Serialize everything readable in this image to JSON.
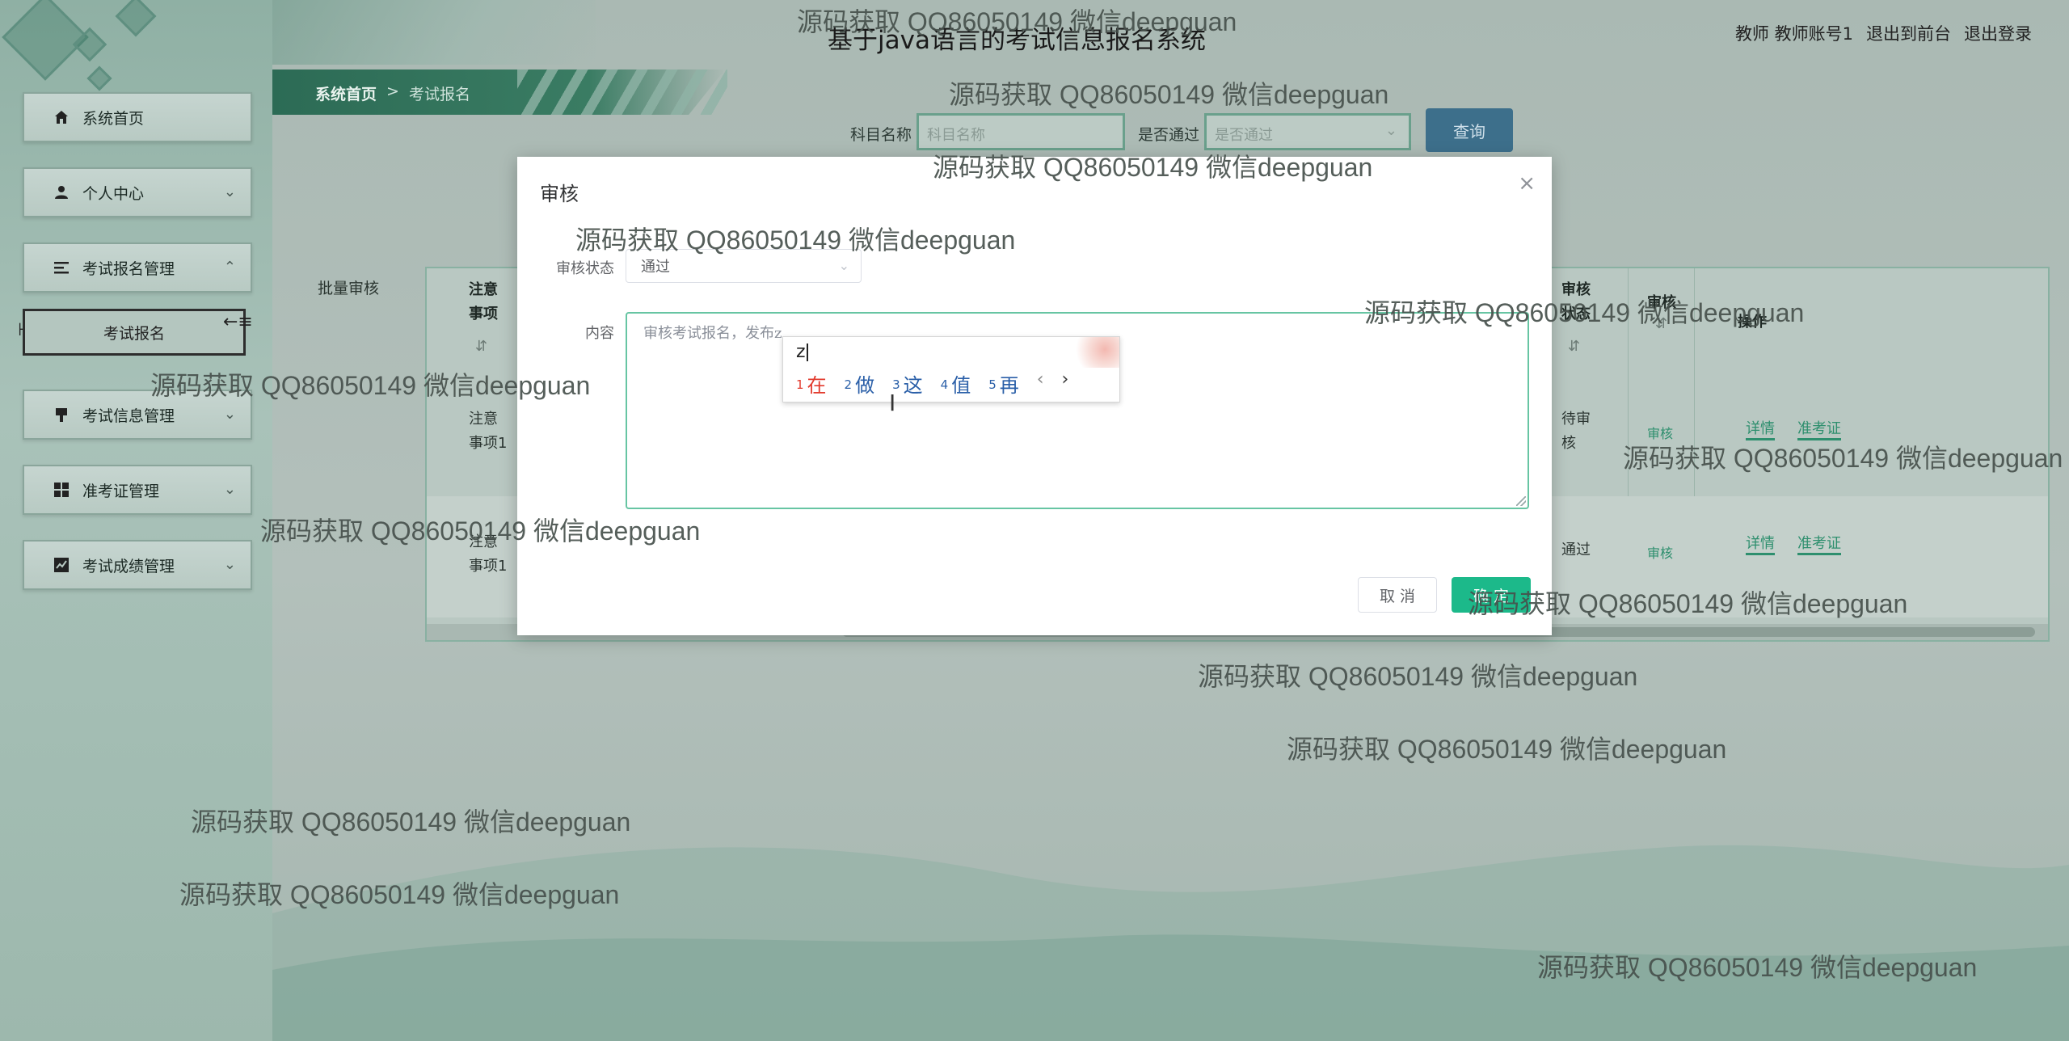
{
  "header": {
    "app_title": "基于java语言的考试信息报名系统",
    "user_role": "教师",
    "user_name": "教师账号1",
    "to_frontend": "退出到前台",
    "logout": "退出登录"
  },
  "breadcrumb": {
    "home": "系统首页",
    "separator": ">",
    "current": "考试报名"
  },
  "sidebar": {
    "items": [
      {
        "label": "系统首页",
        "icon": "home-icon"
      },
      {
        "label": "个人中心",
        "icon": "user-icon"
      },
      {
        "label": "考试报名管理",
        "icon": "list-icon",
        "expanded": true,
        "children": [
          "考试报名"
        ]
      },
      {
        "label": "考试信息管理",
        "icon": "pin-icon"
      },
      {
        "label": "准考证管理",
        "icon": "grid-icon"
      },
      {
        "label": "考试成绩管理",
        "icon": "chart-icon"
      }
    ]
  },
  "search": {
    "subject_label": "科目名称",
    "subject_placeholder": "科目名称",
    "passed_label": "是否通过",
    "passed_placeholder": "是否通过",
    "query_button": "查询"
  },
  "table": {
    "batch_review": "批量审核",
    "headers": {
      "notes": "注意事项",
      "review_status": "审核状态",
      "review": "审核",
      "actions": "操作"
    },
    "rows": [
      {
        "notes": "注意事项1",
        "status": "待审核",
        "review": "审核",
        "detail": "详情",
        "ticket": "准考证"
      },
      {
        "notes": "注意事项1",
        "status": "通过",
        "review": "审核",
        "detail": "详情",
        "ticket": "准考证"
      }
    ]
  },
  "modal": {
    "title": "审核",
    "status_label": "审核状态",
    "status_value": "通过",
    "content_label": "内容",
    "content_value": "审核考试报名，发布z",
    "cancel": "取 消",
    "confirm": "确 定"
  },
  "ime": {
    "composition": "z",
    "candidates": [
      {
        "num": "1",
        "text": "在"
      },
      {
        "num": "2",
        "text": "做"
      },
      {
        "num": "3",
        "text": "这"
      },
      {
        "num": "4",
        "text": "值"
      },
      {
        "num": "5",
        "text": "再"
      }
    ],
    "prev": "‹",
    "next": "›"
  },
  "watermark": "源码获取 QQ86050149 微信deepguan",
  "colors": {
    "accent": "#1cb98a",
    "sidebar_dark": "#2c6b55",
    "link": "#2e8f6e"
  }
}
